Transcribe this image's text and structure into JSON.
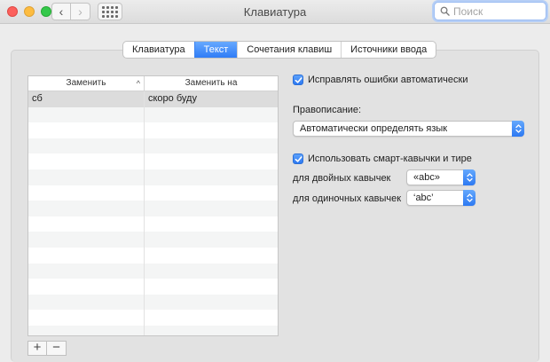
{
  "window": {
    "title": "Клавиатура"
  },
  "search": {
    "placeholder": "Поиск"
  },
  "tabs": [
    {
      "label": "Клавиатура",
      "active": false
    },
    {
      "label": "Текст",
      "active": true
    },
    {
      "label": "Сочетания клавиш",
      "active": false
    },
    {
      "label": "Источники ввода",
      "active": false
    }
  ],
  "table": {
    "col_replace": "Заменить",
    "col_with": "Заменить на",
    "rows": [
      {
        "replace": "сб",
        "with": "скоро буду"
      }
    ]
  },
  "table_buttons": {
    "add": "+",
    "remove": "−"
  },
  "options": {
    "autocorrect": {
      "label": "Исправлять ошибки автоматически",
      "checked": true
    },
    "spelling_label": "Правописание:",
    "spelling_value": "Автоматически определять язык",
    "smart_quotes": {
      "label": "Использовать смарт-кавычки и тире",
      "checked": true
    },
    "double_quotes_label": "для двойных кавычек",
    "double_quotes_value": "«abc»",
    "single_quotes_label": "для одиночных кавычек",
    "single_quotes_value": "‘abc’"
  },
  "colors": {
    "accent": "#2f7cf6"
  }
}
